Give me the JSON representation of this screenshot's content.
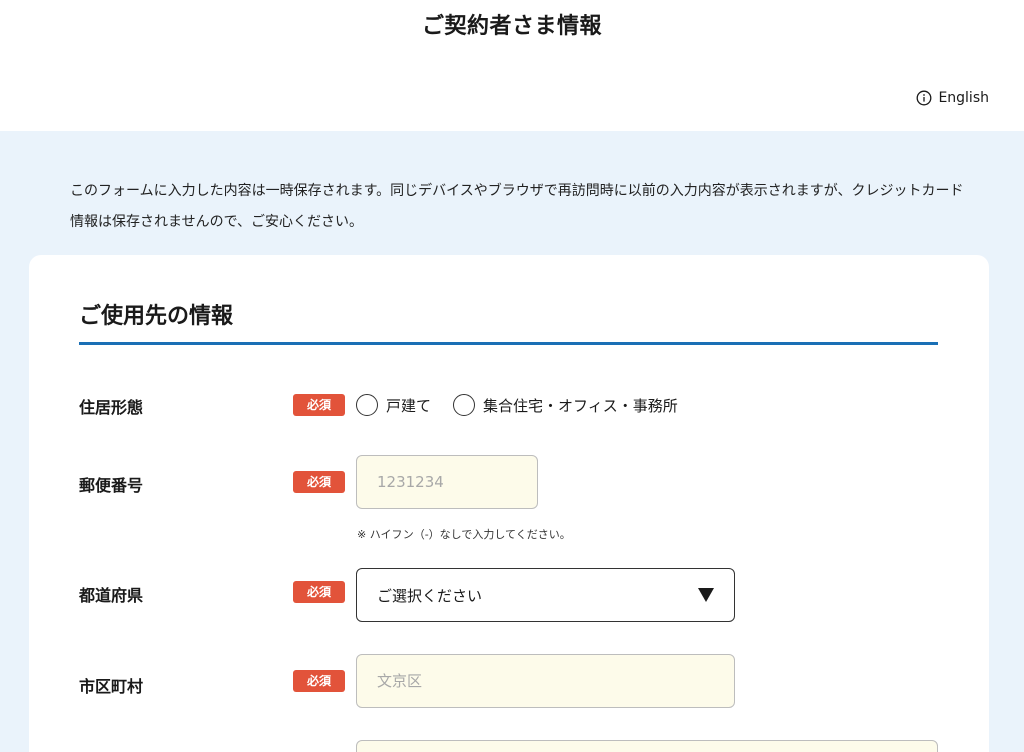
{
  "header": {
    "title": "ご契約者さま情報",
    "language_link": "English",
    "language_icon": "info-icon"
  },
  "notice": {
    "text": "このフォームに入力した内容は一時保存されます。同じデバイスやブラウザで再訪問時に以前の入力内容が表示されますが、クレジットカード情報は保存されませんので、ご安心ください。"
  },
  "section": {
    "title": "ご使用先の情報",
    "rule_color": "#1a6fb5"
  },
  "required_badge": "必須",
  "fields": {
    "residence_type": {
      "label": "住居形態",
      "options": [
        "戸建て",
        "集合住宅・オフィス・事務所"
      ]
    },
    "postal_code": {
      "label": "郵便番号",
      "placeholder": "1231234",
      "hint": "※ ハイフン（-）なしで入力してください。"
    },
    "prefecture": {
      "label": "都道府県",
      "selected": "ご選択ください"
    },
    "city": {
      "label": "市区町村",
      "placeholder": "文京区"
    },
    "next_field": {
      "placeholder": ""
    }
  },
  "colors": {
    "band_background": "#eaf3fb",
    "required_badge": "#e2533a",
    "input_background": "#fdfbea"
  }
}
